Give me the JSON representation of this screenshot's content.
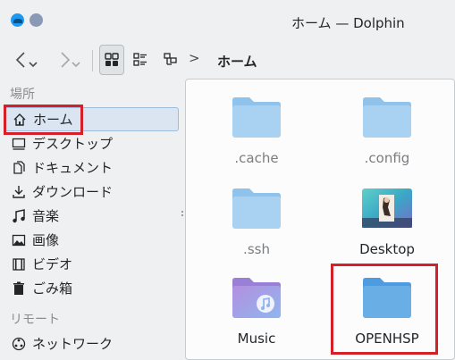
{
  "window": {
    "title": "ホーム — Dolphin",
    "app_icon": "dolphin-icon"
  },
  "toolbar": {
    "back_icon": "back-arrow-icon",
    "forward_icon": "forward-arrow-icon",
    "view_modes": [
      "icons-view-icon",
      "compact-view-icon",
      "tree-view-icon"
    ],
    "breadcrumb_separator": ">",
    "breadcrumb": "ホーム"
  },
  "places": {
    "group_places": "場所",
    "group_remote": "リモート",
    "items": [
      {
        "label": "ホーム",
        "icon": "home-icon",
        "selected": true
      },
      {
        "label": "デスクトップ",
        "icon": "desktop-icon"
      },
      {
        "label": "ドキュメント",
        "icon": "documents-icon"
      },
      {
        "label": "ダウンロード",
        "icon": "download-icon"
      },
      {
        "label": "音楽",
        "icon": "music-icon"
      },
      {
        "label": "画像",
        "icon": "pictures-icon"
      },
      {
        "label": "ビデオ",
        "icon": "video-icon"
      },
      {
        "label": "ごみ箱",
        "icon": "trash-icon"
      }
    ],
    "remote_items": [
      {
        "label": "ネットワーク",
        "icon": "network-icon"
      }
    ]
  },
  "files": [
    {
      "name": ".cache",
      "icon": "folder-icon",
      "hidden": true
    },
    {
      "name": ".config",
      "icon": "folder-icon",
      "hidden": true
    },
    {
      "name": ".ssh",
      "icon": "folder-icon",
      "hidden": true
    },
    {
      "name": "Desktop",
      "icon": "desktop-folder-thumbnail"
    },
    {
      "name": "Music",
      "icon": "music-folder-icon"
    },
    {
      "name": "OPENHSP",
      "icon": "folder-icon"
    }
  ],
  "colors": {
    "accent": "#3daee9",
    "highlight": "#d42026",
    "folder_light": "#a9d2f2",
    "folder_dark": "#6aaee6"
  }
}
